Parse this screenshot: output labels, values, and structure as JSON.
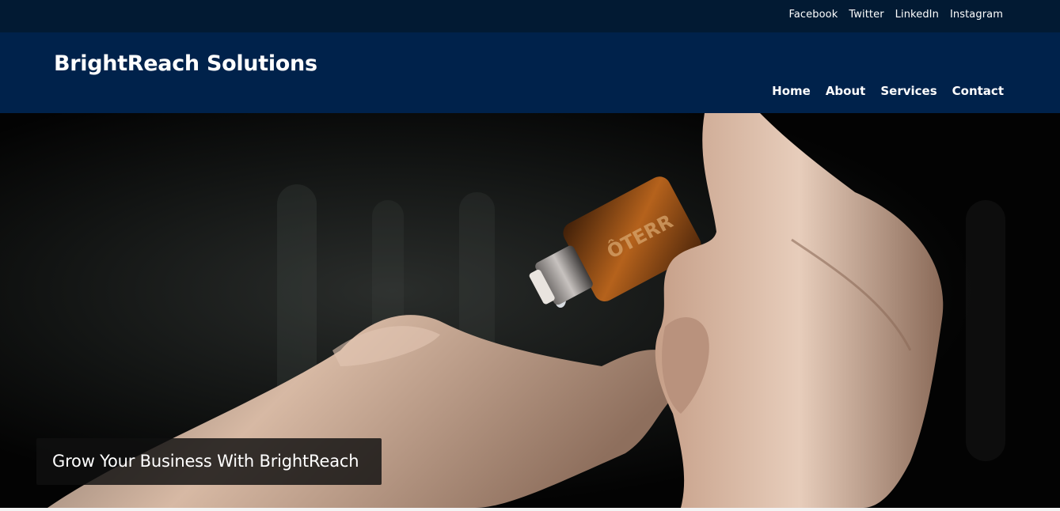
{
  "topbar": {
    "social_links": [
      "Facebook",
      "Twitter",
      "LinkedIn",
      "Instagram"
    ]
  },
  "header": {
    "brand": "BrightReach Solutions",
    "nav": [
      "Home",
      "About",
      "Services",
      "Contact"
    ]
  },
  "hero": {
    "image_label": "hands-with-essential-oil-bottle",
    "bottle_text": "ÔTERR",
    "caption": "Grow Your Business With BrightReach"
  },
  "colors": {
    "topbar_bg": "#021a33",
    "header_bg": "#00224b",
    "text": "#ffffff"
  }
}
